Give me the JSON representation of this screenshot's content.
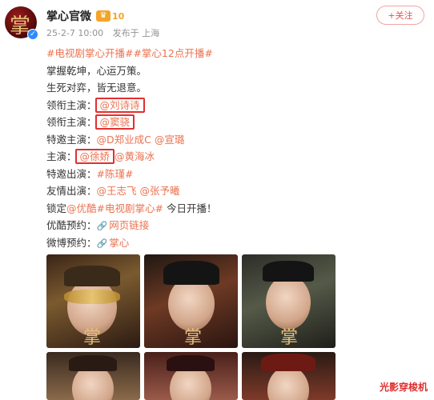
{
  "post": {
    "author": "掌心官微",
    "vip_level": "10",
    "date": "25-2-7 10:00",
    "source": "发布于 上海",
    "follow_label": "+关注"
  },
  "content": {
    "hashtags": "#电视剧掌心开播##掌心12点开播#",
    "line1": "掌握乾坤，心运万策。",
    "line2": "生死对弈，皆无退意。",
    "lead_label": "领衔主演：",
    "lead1": "@刘诗诗",
    "lead2": "@窦骁",
    "special_label": "特邀主演：",
    "special_actors": "@D郑业成C @宣璐",
    "main_label": "主演：",
    "main1": "@徐娇",
    "main2": "@黄海冰",
    "special_appear_label": "特邀出演：",
    "special_appear": "#陈瑾#",
    "friend_label": "友情出演：",
    "friend_actors": "@王志飞 @张予曦",
    "lock_prefix": "锁定",
    "lock_youku": "@优酷",
    "lock_tag": "#电视剧掌心#",
    "lock_suffix": " 今日开播！",
    "youku_label": "优酷预约：",
    "youku_link": "网页链接",
    "weibo_label": "微博预约：",
    "weibo_link": "掌心"
  },
  "watermark": "光影穿梭机",
  "colors": {
    "link": "#eb7350",
    "highlight_box": "#e03030",
    "follow": "#e35353",
    "vip": "#f3a52a"
  },
  "icons": {
    "verified": "verified-badge-icon",
    "vip": "crown-icon",
    "link": "link-chain-icon"
  }
}
